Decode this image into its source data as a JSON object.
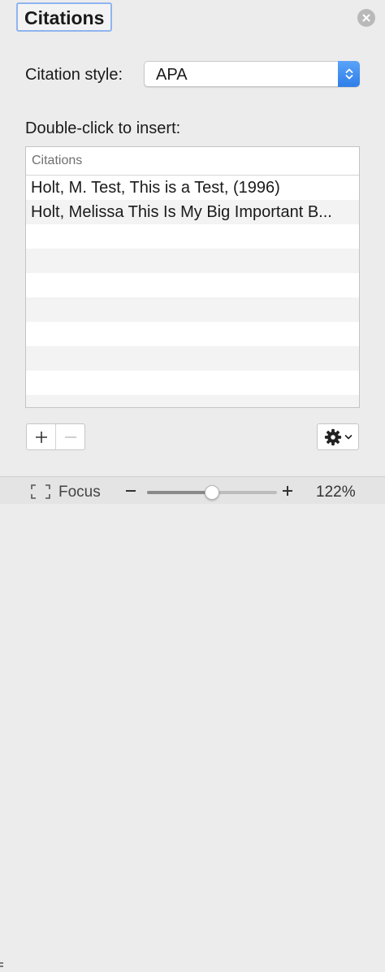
{
  "panel": {
    "title": "Citations",
    "style_label": "Citation style:",
    "style_value": "APA",
    "insert_label": "Double-click to insert:",
    "table": {
      "header": "Citations",
      "rows": [
        "Holt, M. Test, This is a Test, (1996)",
        "Holt, Melissa This Is My Big Important B...",
        "",
        "",
        "",
        "",
        "",
        "",
        "",
        ""
      ]
    }
  },
  "toolbar": {
    "add_label": "+",
    "remove_label": "−",
    "gear_icon": "gear-icon"
  },
  "statusbar": {
    "focus_label": "Focus",
    "zoom_minus": "−",
    "zoom_plus": "+",
    "zoom_level": "122%",
    "zoom_slider_fraction": 0.5
  },
  "colors": {
    "accent": "#3b86ee",
    "title_focus_ring": "#8fb4ef",
    "close_button": "#b9b9b9"
  }
}
